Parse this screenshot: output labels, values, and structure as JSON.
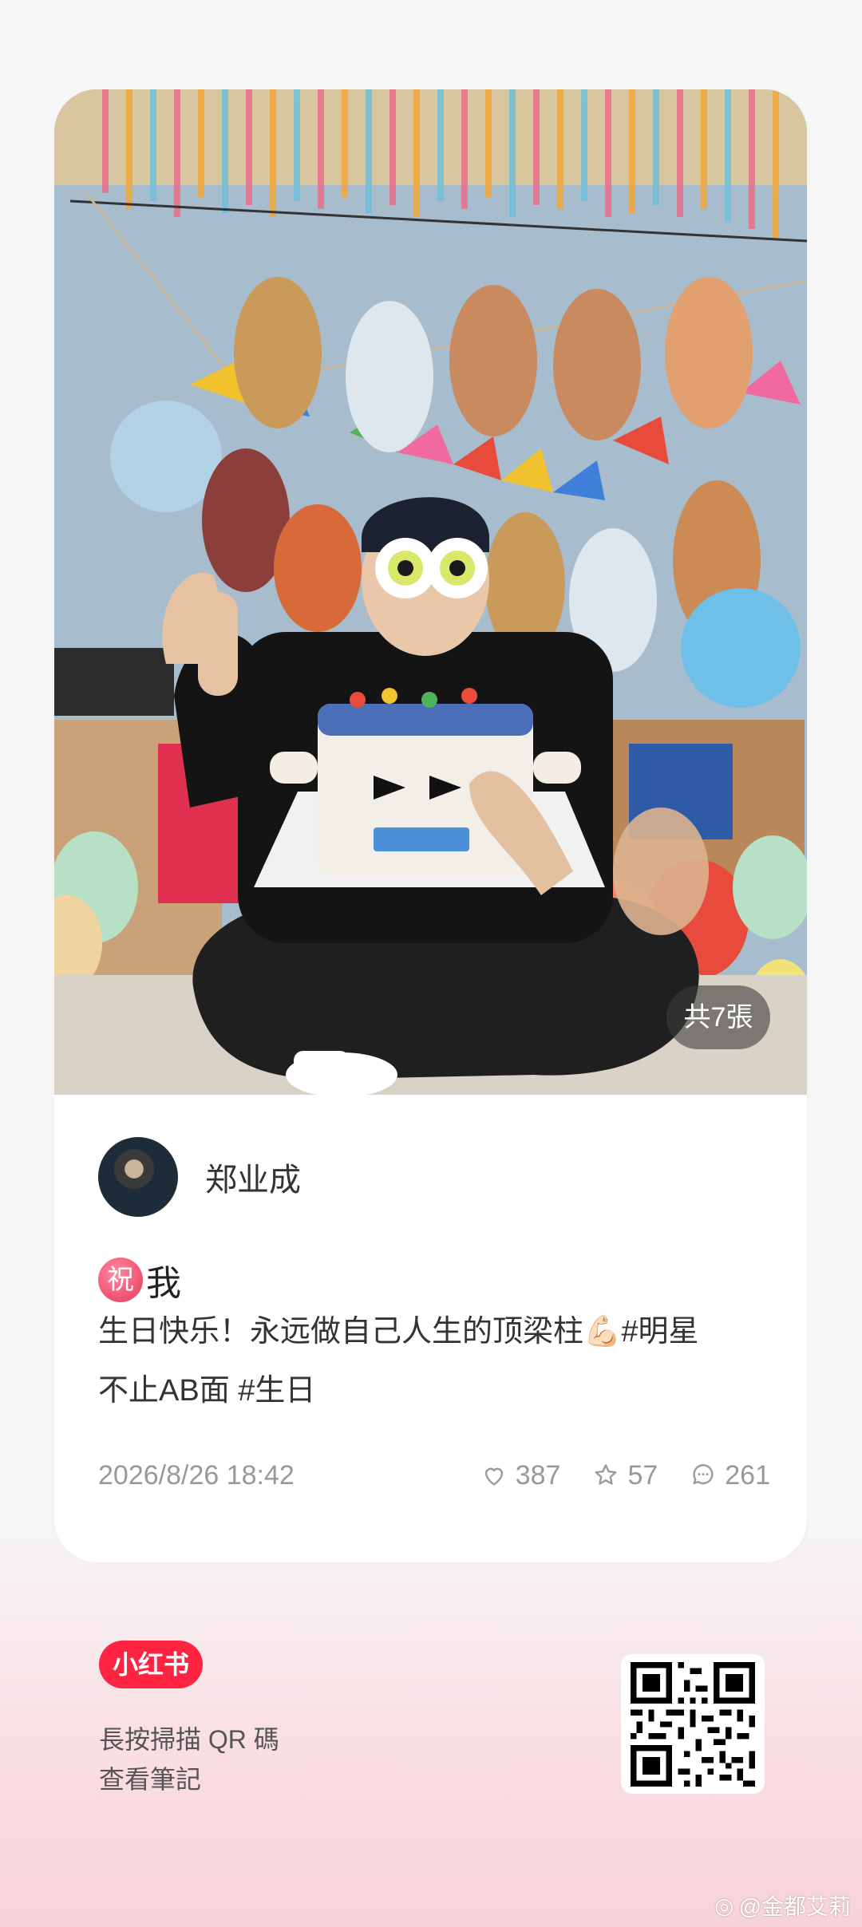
{
  "post": {
    "photo_count_label": "共7張",
    "author_name": "郑业成",
    "title_badge": "祝",
    "title_text": "我",
    "body_line1": "生日快乐！永远做自己人生的顶梁柱",
    "body_emoji": "💪🏻",
    "body_line1_tail": "#明星",
    "body_line2": "不止AB面 #生日",
    "timestamp": "2026/8/26 18:42",
    "likes": "387",
    "collects": "57",
    "comments": "261"
  },
  "footer": {
    "brand_label": "小红书",
    "scan_line1": "長按掃描 QR 碼",
    "scan_line2": "查看筆記"
  },
  "watermark": {
    "text": "@金都艾莉"
  },
  "icons": {
    "like": "heart-icon",
    "collect": "star-icon",
    "comment": "comment-bubble-icon"
  },
  "colors": {
    "brand": "#ff2442",
    "title_badge": "#e8365b"
  }
}
